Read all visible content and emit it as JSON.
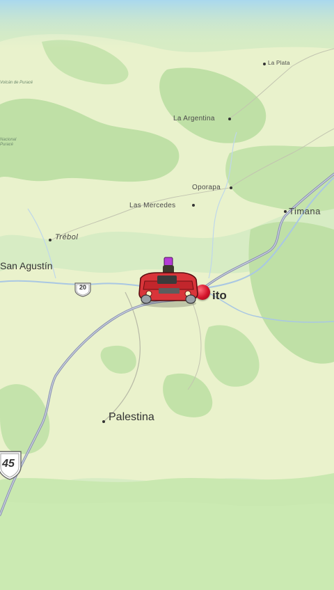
{
  "map": {
    "colors": {
      "forest": "#bfe0a6",
      "clearing": "#eef3cf",
      "water": "#a9d0ea",
      "highway": "#8f98b4",
      "river": "#a9c7e3",
      "vehicle": "#d9353a",
      "pin": "#d4132a"
    },
    "places": {
      "la_plata": "La Plata",
      "la_argentina": "La Argentina",
      "oporapa": "Oporapa",
      "las_mercedes": "Las Mercedes",
      "timana": "Timana",
      "trebol": "Trébol",
      "san_agustin": "San Agustín",
      "pitalito_partial": "ito",
      "palestina": "Palestina"
    },
    "park_labels": {
      "volcan_purace": "Volcán de Puracé",
      "nacional_purace": "Nacional\nPuracé"
    },
    "road_shields": {
      "route_20": "20",
      "route_45": "45"
    },
    "vehicle_icon": "red-jeep-icon",
    "destination_icon": "red-pin-icon"
  }
}
